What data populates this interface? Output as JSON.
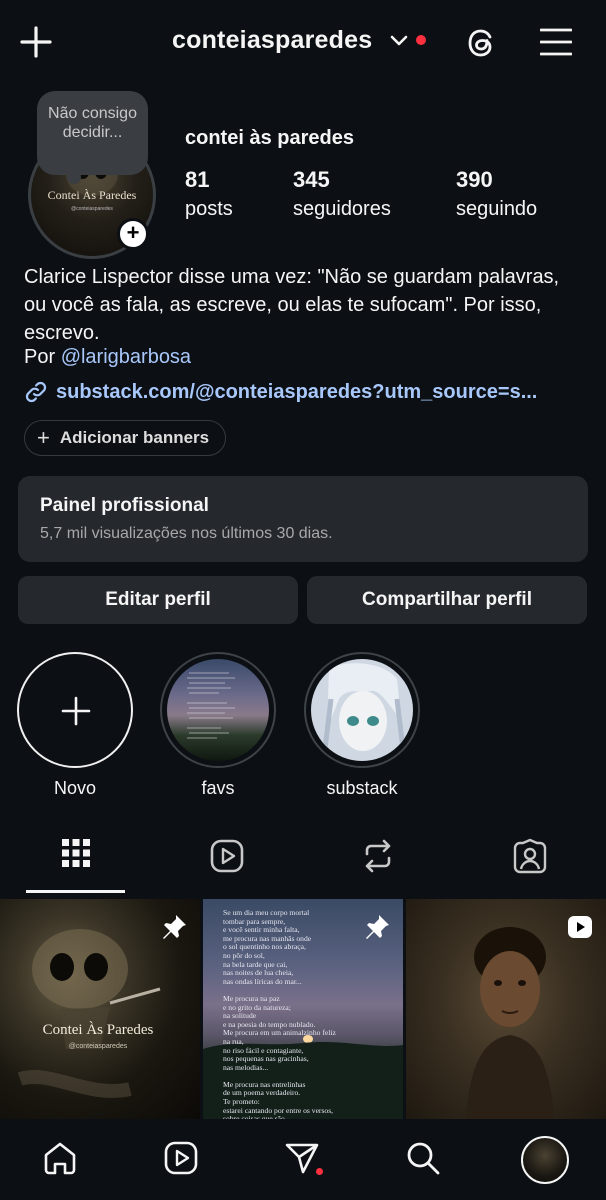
{
  "header": {
    "username": "conteiasparedes",
    "new_post_icon": "plus-icon",
    "threads_icon": "threads-icon",
    "menu_icon": "hamburger-menu-icon"
  },
  "profile": {
    "note": "Não consigo decidir...",
    "avatar_text": "Contei Às Paredes",
    "avatar_handle": "@conteiasparedes",
    "display_name": "contei às paredes",
    "stats": [
      {
        "value": "81",
        "label": "posts"
      },
      {
        "value": "345",
        "label": "seguidores"
      },
      {
        "value": "390",
        "label": "seguindo"
      }
    ],
    "bio": "Clarice Lispector disse uma vez: \"Não se guardam palavras, ou você as fala, as escreve, ou elas te sufocam\". Por isso, escrevo.",
    "bio_by_prefix": "Por ",
    "bio_mention": "@larigbarbosa",
    "link": "substack.com/@conteiasparedes?utm_source=s...",
    "add_banners": "Adicionar banners"
  },
  "pro_panel": {
    "title": "Painel profissional",
    "subtitle": "5,7 mil visualizações nos últimos 30 dias."
  },
  "actions": {
    "edit": "Editar perfil",
    "share": "Compartilhar perfil"
  },
  "highlights": [
    {
      "label": "Novo"
    },
    {
      "label": "favs"
    },
    {
      "label": "substack"
    }
  ],
  "tabs": [
    "grid-icon",
    "reels-icon",
    "reposts-icon",
    "tagged-icon"
  ],
  "grid": [
    {
      "caption": "Contei Às Paredes",
      "sub": "@conteiasparedes",
      "pinned": true
    },
    {
      "poem": "Se um dia meu corpo mortal\ntombar para sempre,\ne você sentir minha falta,\nme procura nas manhãs onde\no sol quentinho nos abraça,\nno pôr do sol,\nna bela tarde que cai,\nnas noites de lua cheia,\nnas ondas líricas do mar...\n\nMe procura na paz\ne no grito da natureza;\nna solitude\ne na poesia do tempo nublado.\nMe procura em um animalzinho feliz\nna rua,\nno riso fácil e contagiante,\nnos pequenas nas gracinhas,\nnas melodias...\n\nMe procura nas entrelinhas\nde um poema verdadeiro.\nTe prometo:\nestarei cantando por entre os versos,\nsobre coisas que são.\n\n- Larissa Gabrielle",
      "pinned": true
    },
    {
      "type": "reel"
    }
  ],
  "bottom_nav": [
    "home-icon",
    "reels-icon",
    "messages-icon",
    "search-icon",
    "profile-icon"
  ],
  "colors": {
    "accent_link": "#a8c7fa",
    "badge": "#ff3040",
    "panel": "#25292e",
    "bg": "#0c1014"
  }
}
